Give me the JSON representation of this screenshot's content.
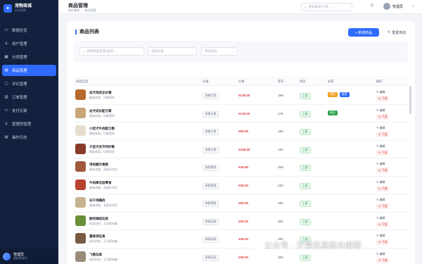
{
  "brand": {
    "name": "宠物商城",
    "sub": "后台管理"
  },
  "nav": [
    {
      "label": "数据总览",
      "icon": "▭",
      "active": false
    },
    {
      "label": "用户管理",
      "icon": "♙",
      "active": false
    },
    {
      "label": "分类管理",
      "icon": "▦",
      "active": false
    },
    {
      "label": "商品管理",
      "icon": "▤",
      "active": true
    },
    {
      "label": "评论管理",
      "icon": "▢",
      "active": false
    },
    {
      "label": "订单管理",
      "icon": "▥",
      "active": false
    },
    {
      "label": "支付记录",
      "icon": "▭",
      "active": false
    },
    {
      "label": "管理员管理",
      "icon": "♙",
      "active": false
    },
    {
      "label": "操作日志",
      "icon": "▤",
      "active": false
    }
  ],
  "user": {
    "name": "管理员",
    "role": "超级管理员"
  },
  "header": {
    "title": "商品管理",
    "breadcrumb": [
      "首页管理",
      "/",
      "商品管理"
    ],
    "search_placeholder": "搜索菜单/订单…",
    "user": "管理员"
  },
  "card": {
    "title": "商品列表",
    "add_label": "+ 新增商品",
    "reset_label": "重置筛选",
    "search_placeholder": "搜索商品名称/品牌…",
    "category_placeholder": "选择分类",
    "status_placeholder": "商品状态"
  },
  "columns": [
    "商品信息",
    "分类",
    "价格",
    "库存",
    "状态",
    "标签",
    "操作"
  ],
  "rows": [
    {
      "name": "成犬鸡肉全价粮",
      "desc": "精选肉类，均衡营养",
      "category": "狗粮主食",
      "price": "¥129.00",
      "stock": "159",
      "status": "上架",
      "tags": [
        "热销",
        "推荐"
      ],
      "edit": "编辑",
      "del": "下架"
    },
    {
      "name": "幼犬成长配方粮",
      "desc": "精选肉类，均衡营养",
      "category": "狗粮主食",
      "price": "¥118.00",
      "stock": "175",
      "status": "上架",
      "tags": [
        "新品"
      ],
      "edit": "编辑",
      "del": "下架"
    },
    {
      "name": "小型犬牛肉配方粮",
      "desc": "精选肉类，均衡营养",
      "category": "狗粮主食",
      "price": "¥99.00",
      "stock": "160",
      "status": "上架",
      "tags": [],
      "edit": "编辑",
      "del": "下架"
    },
    {
      "name": "大型犬关节呵护粮",
      "desc": "精选肉类，均衡营养",
      "category": "狗粮主食",
      "price": "¥168.00",
      "stock": "120",
      "status": "上架",
      "tags": [],
      "edit": "编辑",
      "del": "下架"
    },
    {
      "name": "鸡肉磨牙香肠",
      "desc": "美味诱猫，奖励好伴侣",
      "category": "狗狗零食",
      "price": "¥39.90",
      "stock": "259",
      "status": "上架",
      "tags": [],
      "edit": "编辑",
      "del": "下架"
    },
    {
      "name": "牛肉棒洁齿零食",
      "desc": "美味诱猫，奖励好伴侣",
      "category": "狗狗零食",
      "price": "¥45.00",
      "stock": "220",
      "status": "上架",
      "tags": [],
      "edit": "编辑",
      "del": "下架"
    },
    {
      "name": "冻干鸡胸肉",
      "desc": "美味诱猫，奖励好伴侣",
      "category": "狗狗零食",
      "price": "¥59.00",
      "stock": "150",
      "status": "上架",
      "tags": [],
      "edit": "编辑",
      "del": "下架"
    },
    {
      "name": "耐咬绳结玩具",
      "desc": "结实耐咬，互动更有趣",
      "category": "狗狗玩具",
      "price": "¥26.00",
      "stock": "300",
      "status": "上架",
      "tags": [],
      "edit": "编辑",
      "del": "下架"
    },
    {
      "name": "漏食球玩具",
      "desc": "结实耐咬，互动更有趣",
      "category": "狗狗玩具",
      "price": "¥35.00",
      "stock": "260",
      "status": "上架",
      "tags": [],
      "edit": "编辑",
      "del": "下架"
    },
    {
      "name": "飞盘玩具",
      "desc": "结实耐咬，互动更有趣",
      "category": "狗狗玩具",
      "price": "¥29.00",
      "stock": "200",
      "status": "上架",
      "tags": [],
      "edit": "编辑",
      "del": "下架"
    }
  ],
  "tag_colors": {
    "热销": "#f0a020",
    "推荐": "#2f6bff",
    "新品": "#2da44e"
  },
  "thumb_colors": [
    "#b76a2c",
    "#c9a57a",
    "#e6ddcf",
    "#8a3b2a",
    "#a05a3b",
    "#b8432f",
    "#c7b38f",
    "#6b8e3a",
    "#7a5a43",
    "#9a8c7a"
  ],
  "watermark": "公众号 · 计算机基础与编程"
}
